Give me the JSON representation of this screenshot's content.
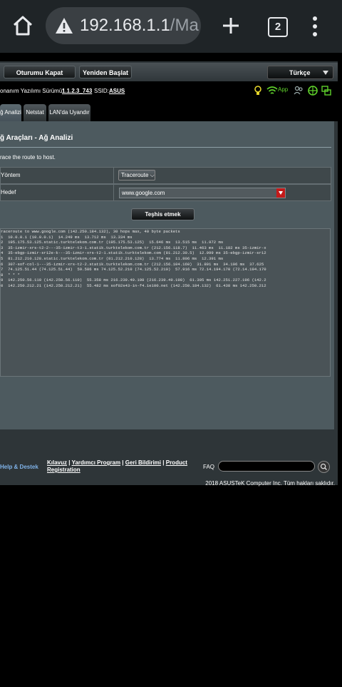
{
  "browser": {
    "url_host": "192.168.1.1",
    "url_rest": "/Ma",
    "tab_count": "2"
  },
  "topbar": {
    "logout_label": "Oturumu Kapat",
    "reboot_label": "Yeniden Başlat",
    "language": "Türkçe"
  },
  "info": {
    "firmware_label": "onanım Yazılımı Sürümü:",
    "firmware_version": "1.1.2.3_743",
    "ssid_label": "SSID:",
    "ssid": "ASUS",
    "app_label": "App"
  },
  "tabs": [
    "ğ Analizi",
    "Netstat",
    "LAN'da Uyandır"
  ],
  "main": {
    "title": "ğ Araçları - Ağ Analizi",
    "description": "race the route to host.",
    "method_label": "Yöntem",
    "method_value": "Traceroute",
    "target_label": "Hedef",
    "target_value": "www.google.com",
    "diagnose_label": "Teşhis etmek",
    "output_lines": [
      "raceroute to www.google.com (142.250.184.132), 30 hops max, 40 byte packets",
      "1  10.0.0.1 (10.0.0.1)  14.249 ms  13.712 ms  13.334 ms",
      "2  195.175.53.125.static.turktelekom.com.tr (195.175.53.125)  15.646 ms  13.515 ms  11.972 ms",
      "3  35-izmir-xrs-t2-2---35-izmir-t3-1.statik.turktelekom.com.tr (212.156.118.7)  11.463 ms  11.182 ms 35-izmir-x",
      "4  35-ebgp-izmir-sr12e-k---35-izmir-xrs-t2-1.statik.turktelekom.com (81.212.30.5)  12.999 ms 35-ebgp-izmir-sr12",
      "5  81.212.210.128.static.turktelekom.com.tr (81.212.210.128)  13.774 ms  11.806 ms  12.391 ms",
      "6  307-sof-col-1---35-izmir-xrs-t2-2.statik.turktelekom.com.tr (212.156.104.160)  31.891 ms  34.106 ms  37.625",
      "7  74.125.51.44 (74.125.51.44)  59.586 ms 74.125.52.210 (74.125.52.210)  57.916 ms 72.14.194.170 (72.14.194.170",
      "8  * * *",
      "9  142.250.56.110 (142.250.56.110)  55.358 ms 216.239.49.198 (216.239.49.198)  61.305 ms 142.251.227.196 (142.2",
      "0  142.250.212.21 (142.250.212.21)  55.482 ms sof02s43-in-f4.1e100.net (142.250.184.132)  61.438 ms 142.250.212"
    ]
  },
  "footer": {
    "help": "Help & Destek",
    "link_manual": "Kılavuz",
    "link_utility": "Yardımcı Program",
    "link_feedback": "Geri Bildirimi",
    "link_registration": "Product Registration",
    "sep": "|",
    "faq": "FAQ",
    "copyright": "2018 ASUSTeK Computer Inc. Tüm hakları saklıdır."
  },
  "colors": {
    "accent_red": "#c41a1a",
    "help_blue": "#7fb2e8",
    "status_green": "#5fd12b",
    "status_yellow": "#e5d52a"
  }
}
